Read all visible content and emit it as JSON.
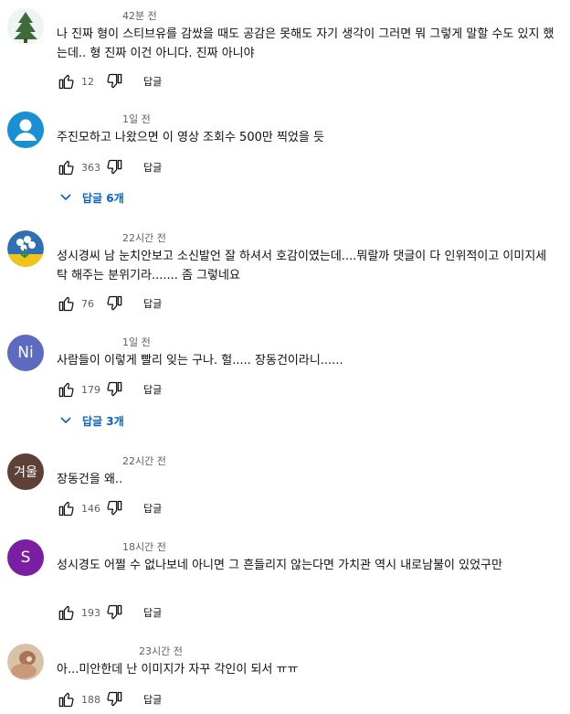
{
  "reply_label": "답글",
  "comments": [
    {
      "time": "42분 전",
      "text": "나 진짜 형이 스티브유를 감쌌을 때도 공감은 못해도 자기 생각이 그러면 뭐 그렇게 말할 수도 있지 했는데.. 형 진짜 이건 아니다. 진짜 아니야",
      "likes": "12",
      "avatar_icon": "tree-avatar-icon"
    },
    {
      "time": "1일 전",
      "text": "주진모하고 나왔으면 이 영상 조회수 500만 찍었을 듯",
      "likes": "363",
      "avatar_icon": "default-person-icon",
      "avatar_color": "#1a8fd4",
      "replies_label": "답글 6개"
    },
    {
      "time": "22시간 전",
      "text": "성시경씨 남 눈치안보고 소신발언 잘 하셔서 호감이였는데....뭐랄까 댓글이 다 인위적이고 이미지세탁 해주는 분위기라....... 좀 그렇네요",
      "likes": "76",
      "avatar_icon": "flower-avatar-icon"
    },
    {
      "time": "1일 전",
      "text": "사람들이 이렇게 빨리 잊는 구나. 헐..... 장동건이라니......",
      "likes": "179",
      "avatar_letter": "Ni",
      "avatar_color": "#5c6bc0",
      "replies_label": "답글 3개"
    },
    {
      "time": "22시간 전",
      "text": "장동건을 왜..",
      "likes": "146",
      "avatar_letter": "겨울",
      "avatar_color": "#5d4037"
    },
    {
      "time": "18시간 전",
      "text": "성시경도 어쩔 수 없나보네 아니면 그 흔들리지 않는다면 가치관 역시 내로남불이 있었구만",
      "likes": "193",
      "avatar_letter": "S",
      "avatar_color": "#7b1fa2"
    },
    {
      "time": "23시간 전",
      "text": "아...미안한데 난 이미지가 자꾸 각인이 되서 ㅠㅠ",
      "likes": "188",
      "avatar_icon": "photo-avatar-icon"
    }
  ]
}
